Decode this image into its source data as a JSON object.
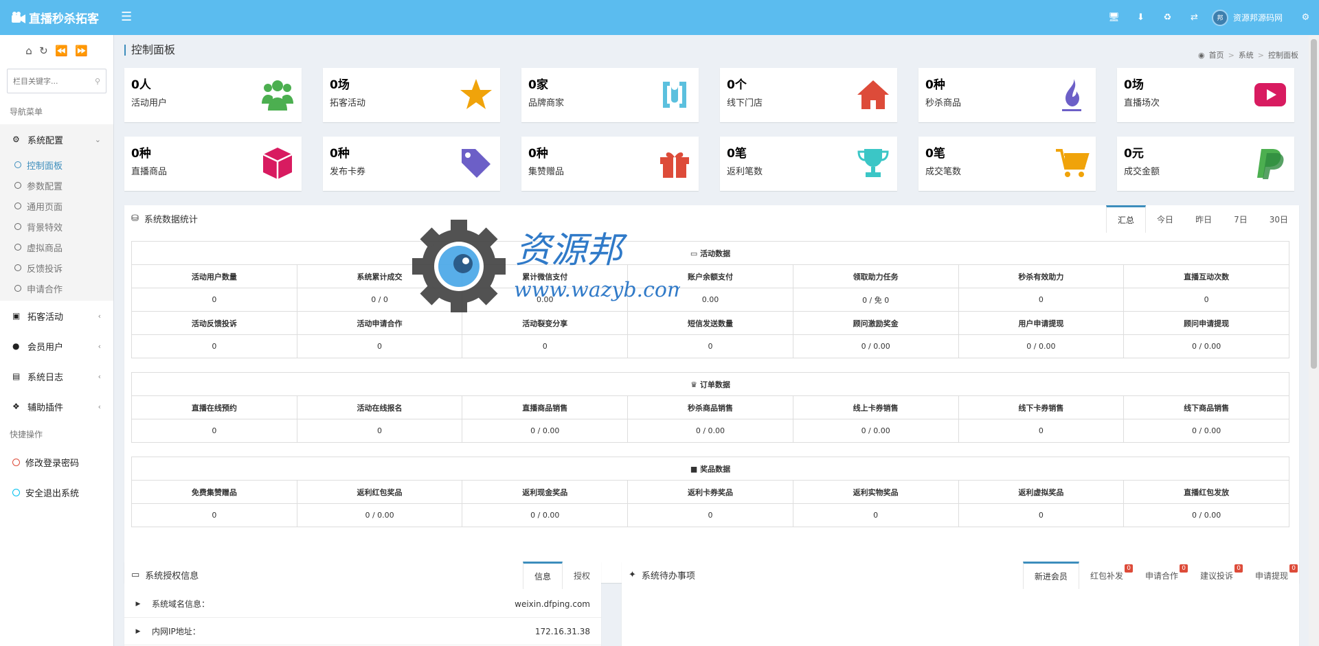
{
  "header": {
    "app_title": "直播秒杀拓客",
    "user_name": "资源邦源码网",
    "icons": [
      "monitor-icon",
      "download-icon",
      "recycle-icon",
      "shuffle-icon",
      "gear-icon"
    ]
  },
  "sidebar": {
    "search_placeholder": "栏目关键字...",
    "nav_heading": "导航菜单",
    "groups": [
      {
        "label": "系统配置"
      },
      {
        "label": "拓客活动"
      },
      {
        "label": "会员用户"
      },
      {
        "label": "系统日志"
      },
      {
        "label": "辅助插件"
      }
    ],
    "subitems": [
      "控制面板",
      "参数配置",
      "通用页面",
      "背景特效",
      "虚拟商品",
      "反馈投诉",
      "申请合作"
    ],
    "quick_heading": "快捷操作",
    "quick": [
      "修改登录密码",
      "安全退出系统"
    ]
  },
  "page": {
    "title": "控制面板",
    "breadcrumb": [
      "首页",
      "系统",
      "控制面板"
    ]
  },
  "stats": [
    {
      "num": "0人",
      "label": "活动用户",
      "icon": "users-icon",
      "color": "#4caf50"
    },
    {
      "num": "0场",
      "label": "拓客活动",
      "icon": "star-icon",
      "color": "#f0a30a"
    },
    {
      "num": "0家",
      "label": "品牌商家",
      "icon": "brand-icon",
      "color": "#5bc0de"
    },
    {
      "num": "0个",
      "label": "线下门店",
      "icon": "home-icon",
      "color": "#dd4b39"
    },
    {
      "num": "0种",
      "label": "秒杀商品",
      "icon": "flame-icon",
      "color": "#6c5fc7"
    },
    {
      "num": "0场",
      "label": "直播场次",
      "icon": "play-icon",
      "color": "#d81b60"
    },
    {
      "num": "0种",
      "label": "直播商品",
      "icon": "cube-icon",
      "color": "#d81b60"
    },
    {
      "num": "0种",
      "label": "发布卡券",
      "icon": "tag-icon",
      "color": "#6c5fc7"
    },
    {
      "num": "0种",
      "label": "集赞赠品",
      "icon": "gift-icon",
      "color": "#dd4b39"
    },
    {
      "num": "0笔",
      "label": "返利笔数",
      "icon": "trophy-icon",
      "color": "#3bc6c6"
    },
    {
      "num": "0笔",
      "label": "成交笔数",
      "icon": "cart-icon",
      "color": "#f0a30a"
    },
    {
      "num": "0元",
      "label": "成交金额",
      "icon": "paypal-icon",
      "color": "#4caf50"
    }
  ],
  "stats_panel": {
    "title": "系统数据统计",
    "tabs": [
      "汇总",
      "今日",
      "昨日",
      "7日",
      "30日"
    ],
    "activity": {
      "caption": "活动数据",
      "row1_head": [
        "活动用户数量",
        "系统累计成交",
        "累计微信支付",
        "账户余额支付",
        "领取助力任务",
        "秒杀有效助力",
        "直播互动次数"
      ],
      "row1_vals": [
        "0",
        "0 / 0",
        "0.00",
        "0.00",
        "0 / 免 0",
        "0",
        "0"
      ],
      "row2_head": [
        "活动反馈投诉",
        "活动申请合作",
        "活动裂变分享",
        "短信发送数量",
        "顾问激励奖金",
        "用户申请提现",
        "顾问申请提现"
      ],
      "row2_vals": [
        "0",
        "0",
        "0",
        "0",
        "0 / 0.00",
        "0 / 0.00",
        "0 / 0.00"
      ]
    },
    "orders": {
      "caption": "订单数据",
      "head": [
        "直播在线预约",
        "活动在线报名",
        "直播商品销售",
        "秒杀商品销售",
        "线上卡券销售",
        "线下卡券销售",
        "线下商品销售"
      ],
      "vals": [
        "0",
        "0",
        "0 / 0.00",
        "0 / 0.00",
        "0 / 0.00",
        "0",
        "0 / 0.00"
      ]
    },
    "prizes": {
      "caption": "奖品数据",
      "head": [
        "免费集赞赠品",
        "返利红包奖品",
        "返利现金奖品",
        "返利卡券奖品",
        "返利实物奖品",
        "返利虚拟奖品",
        "直播红包发放"
      ],
      "vals": [
        "0",
        "0 / 0.00",
        "0 / 0.00",
        "0",
        "0",
        "0",
        "0 / 0.00"
      ]
    }
  },
  "auth_panel": {
    "title": "系统授权信息",
    "tabs": [
      "信息",
      "授权"
    ],
    "rows": [
      {
        "k": "系统域名信息：",
        "v": "weixin.dfping.com"
      },
      {
        "k": "内网IP地址：",
        "v": "172.16.31.38"
      }
    ]
  },
  "todo_panel": {
    "title": "系统待办事项",
    "tabs": [
      {
        "label": "新进会员",
        "badge": ""
      },
      {
        "label": "红包补发",
        "badge": "0"
      },
      {
        "label": "申请合作",
        "badge": "0"
      },
      {
        "label": "建议投诉",
        "badge": "0"
      },
      {
        "label": "申请提现",
        "badge": "0"
      }
    ]
  },
  "watermark": {
    "brand": "资源邦",
    "url": "www.wazyb.com"
  }
}
